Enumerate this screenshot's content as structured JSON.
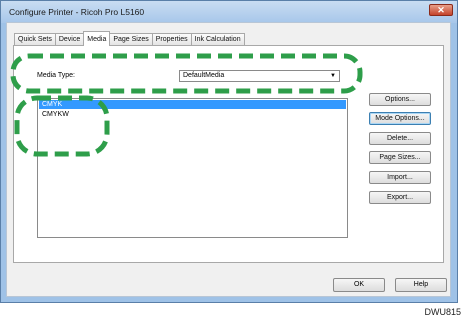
{
  "window": {
    "title": "Configure Printer - Ricoh Pro L5160",
    "close_glyph": "✕"
  },
  "tabs": [
    {
      "label": "Quick Sets",
      "active": false
    },
    {
      "label": "Device",
      "active": false
    },
    {
      "label": "Media",
      "active": true
    },
    {
      "label": "Page Sizes",
      "active": false
    },
    {
      "label": "Properties",
      "active": false
    },
    {
      "label": "Ink Calculation",
      "active": false
    }
  ],
  "media": {
    "label": "Media Type:",
    "selected": "DefaultMedia",
    "arrow": "▼"
  },
  "list": {
    "items": [
      {
        "label": "CMYK",
        "selected": true
      },
      {
        "label": "CMYKW",
        "selected": false
      }
    ]
  },
  "buttons": {
    "options": "Options...",
    "mode_options": "Mode Options...",
    "delete": "Delete...",
    "page_sizes": "Page Sizes...",
    "import": "Import...",
    "export": "Export..."
  },
  "footer": {
    "ok": "OK",
    "help": "Help"
  },
  "figure_code": "DWU815",
  "colors": {
    "highlight_outline": "#2e9e4a",
    "selection": "#3399ff"
  }
}
